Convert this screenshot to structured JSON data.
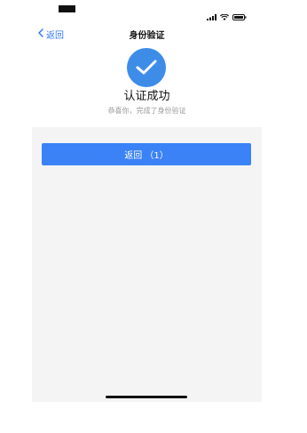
{
  "nav": {
    "back_label": "返回",
    "title": "身份验证"
  },
  "result": {
    "title": "认证成功",
    "subtitle": "恭喜你，完成了身份验证"
  },
  "actions": {
    "return_button_label": "返回 （1）"
  },
  "icons": {
    "back": "chevron-left-icon",
    "success": "checkmark-icon",
    "signal": "signal-icon",
    "wifi": "wifi-icon",
    "battery": "battery-icon"
  },
  "colors": {
    "accent": "#3a82f6",
    "success_circle": "#3d8de8",
    "link": "#3478f6",
    "content_bg": "#f4f4f4"
  }
}
